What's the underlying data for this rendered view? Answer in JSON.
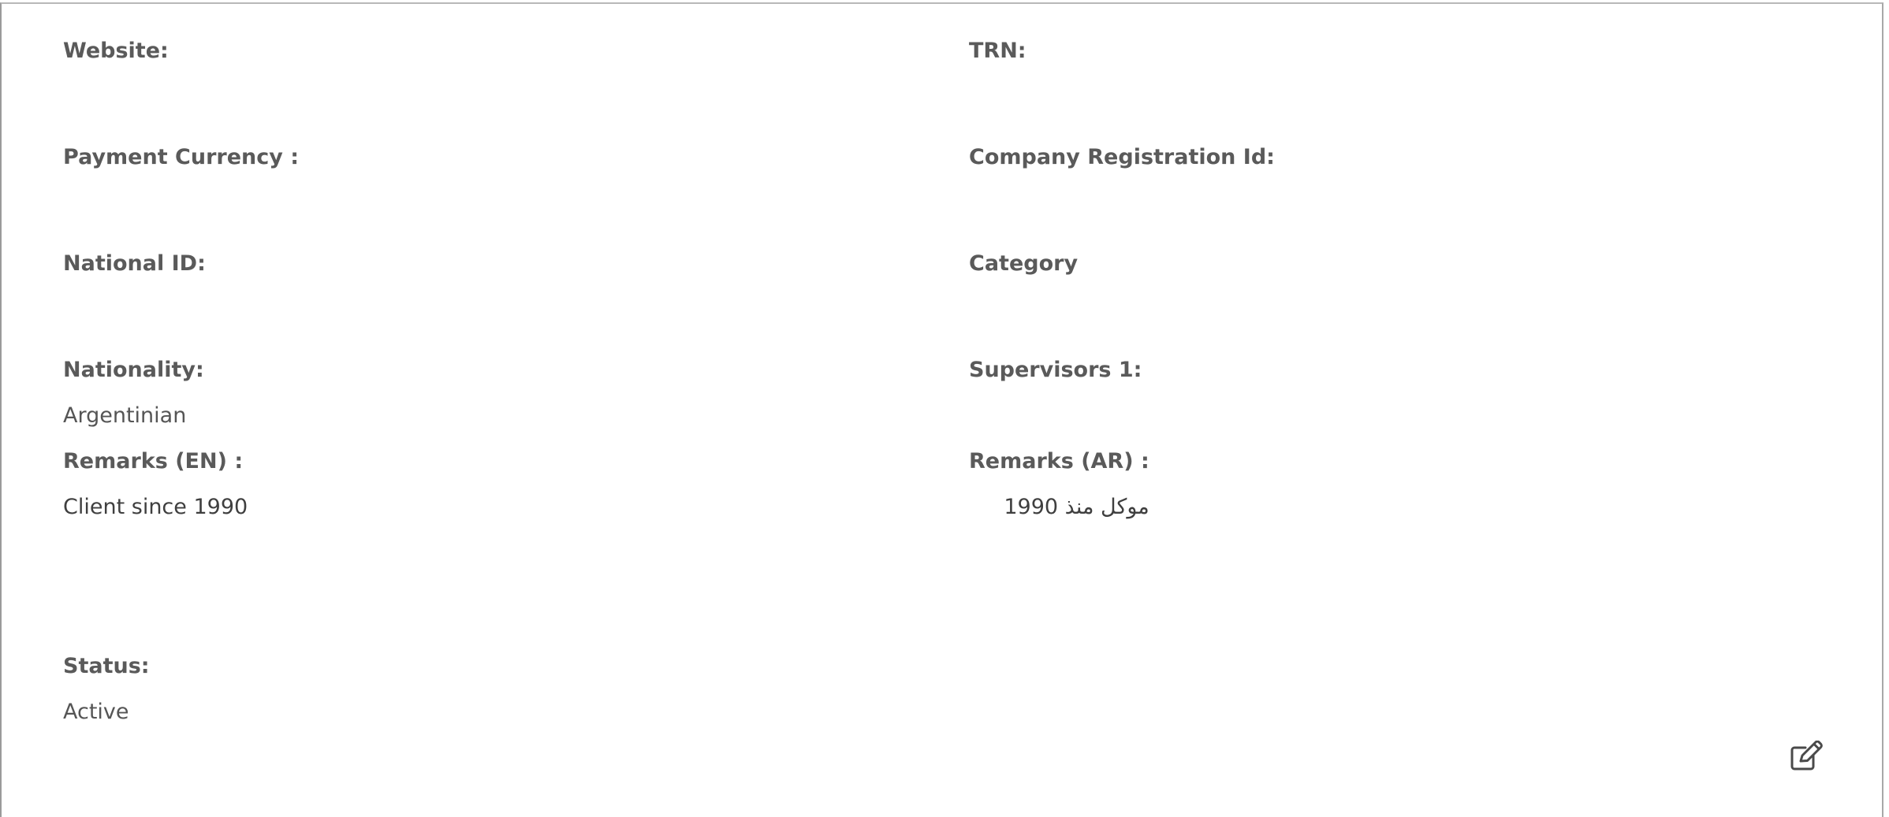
{
  "details": {
    "left": [
      {
        "label": "Website:",
        "value": ""
      },
      {
        "label": "Payment Currency :",
        "value": ""
      },
      {
        "label": "National ID:",
        "value": ""
      },
      {
        "label": "Nationality:",
        "value": "Argentinian"
      },
      {
        "label": "Remarks (EN) :",
        "value": "Client since 1990"
      },
      {
        "label": "Status:",
        "value": "Active"
      }
    ],
    "right": [
      {
        "label": "TRN:",
        "value": ""
      },
      {
        "label": "Company Registration Id:",
        "value": ""
      },
      {
        "label": "Category",
        "value": ""
      },
      {
        "label": "Supervisors 1:",
        "value": ""
      },
      {
        "label": "Remarks (AR) :",
        "value": "موكل منذ 1990"
      }
    ]
  },
  "actions": {
    "edit_icon": "edit-icon"
  }
}
